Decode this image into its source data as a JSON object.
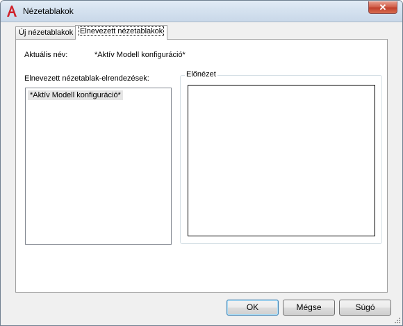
{
  "window": {
    "title": "Nézetablakok",
    "close_symbol": "✕"
  },
  "tabs": [
    {
      "label": "Új nézetablakok",
      "active": false
    },
    {
      "label": "Elnevezett nézetablakok",
      "active": true
    }
  ],
  "named_tab": {
    "current_name_label": "Aktuális név:",
    "current_name_value": "*Aktív Modell konfiguráció*",
    "list_label": "Elnevezett nézetablak-elrendezések:",
    "list_items": [
      "*Aktív Modell konfiguráció*"
    ],
    "preview_label": "Előnézet"
  },
  "buttons": {
    "ok": "OK",
    "cancel": "Mégse",
    "help": "Súgó"
  },
  "icons": {
    "app": "autocad-a-icon",
    "close": "close-icon",
    "resize": "resize-grip-icon"
  },
  "colors": {
    "app_icon": "#d0202a",
    "close_button": "#c9503a"
  }
}
